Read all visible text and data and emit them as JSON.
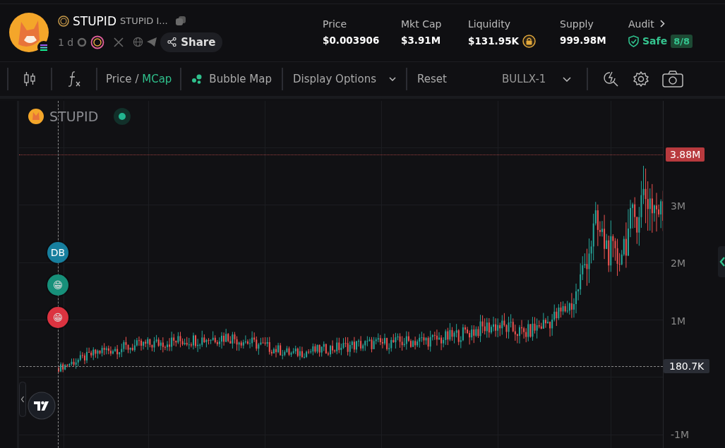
{
  "token": {
    "name": "STUPID",
    "full_name": "STUPID I...",
    "age": "1 d",
    "share_label": "Share"
  },
  "stats": [
    {
      "label": "Price",
      "value": "$0.003906",
      "kind": "plain"
    },
    {
      "label": "Mkt Cap",
      "value": "$3.91M",
      "kind": "plain"
    },
    {
      "label": "Liquidity",
      "value": "$131.95K",
      "kind": "locked"
    },
    {
      "label": "Supply",
      "value": "999.98M",
      "kind": "plain"
    },
    {
      "label": "Audit",
      "value": "Safe",
      "badge": "8/8",
      "kind": "audit"
    }
  ],
  "toolbar": {
    "price_label": "Price",
    "separator": "/",
    "mcap_label": "MCap",
    "mcap_selected": true,
    "bubble_map": "Bubble Map",
    "display_options": "Display Options",
    "reset": "Reset",
    "layout": "BULLX-1"
  },
  "chart": {
    "symbol": "STUPID",
    "live": true,
    "y_ticks": [
      "3M",
      "2M",
      "1M",
      "-1M"
    ],
    "last_price": "3.88M",
    "crosshair_price": "180.7K",
    "markers": [
      {
        "kind": "text",
        "label": "DB",
        "color": "#177f9e"
      },
      {
        "kind": "emoji",
        "label": "😁",
        "color": "#17907a"
      },
      {
        "kind": "emoji",
        "label": "😁",
        "color": "#dc3340"
      }
    ]
  }
}
